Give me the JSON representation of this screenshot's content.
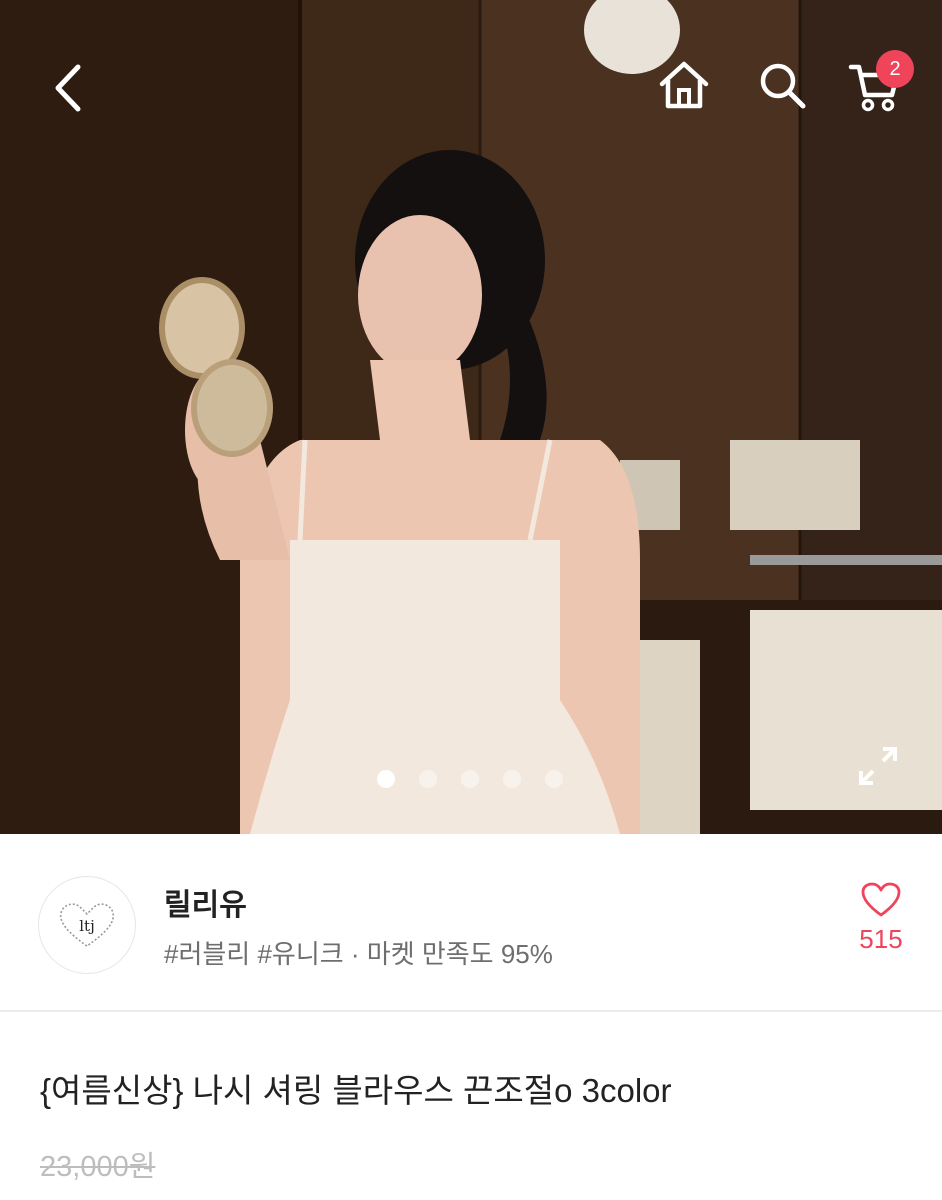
{
  "header": {
    "back_icon": "chevron-left-icon",
    "home_icon": "home-icon",
    "search_icon": "search-icon",
    "cart_icon": "cart-icon",
    "cart_count": "2"
  },
  "gallery": {
    "image_description": "product-photo",
    "total_slides": 5,
    "active_slide": 1,
    "expand_icon": "expand-icon"
  },
  "seller": {
    "name": "릴리유",
    "tags": "#러블리 #유니크 · 마켓 만족도 95%",
    "logo_text": "ltj",
    "like_icon": "heart-icon",
    "like_count": "515"
  },
  "product": {
    "title": "{여름신상} 나시 셔링 블라우스 끈조절o 3color",
    "original_price": "23,000원"
  },
  "colors": {
    "accent": "#f0445b",
    "text": "#222222",
    "muted": "#6e6e6e"
  }
}
